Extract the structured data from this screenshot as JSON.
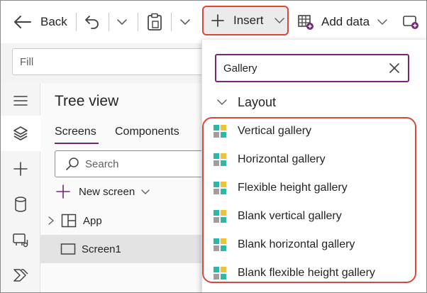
{
  "toolbar": {
    "back_label": "Back",
    "insert_label": "Insert",
    "add_data_label": "Add data"
  },
  "formula": {
    "property_value": "Fill"
  },
  "tree": {
    "title": "Tree view",
    "tabs": [
      {
        "label": "Screens",
        "active": true
      },
      {
        "label": "Components",
        "active": false
      }
    ],
    "search_placeholder": "Search",
    "new_screen_label": "New screen",
    "items": [
      {
        "label": "App",
        "icon": "app-icon"
      },
      {
        "label": "Screen1",
        "icon": "screen-icon",
        "selected": true
      }
    ]
  },
  "insert_menu": {
    "search_value": "Gallery",
    "section_label": "Layout",
    "items": [
      {
        "label": "Vertical gallery"
      },
      {
        "label": "Horizontal gallery"
      },
      {
        "label": "Flexible height gallery"
      },
      {
        "label": "Blank vertical gallery"
      },
      {
        "label": "Blank horizontal gallery"
      },
      {
        "label": "Blank flexible height gallery"
      }
    ]
  },
  "colors": {
    "accent_purple": "#742774",
    "highlight_red": "#d9473e",
    "gallery_icon_teal": "#2fb7a5",
    "gallery_icon_yellow": "#f0c23b",
    "gallery_icon_gray": "#9e9e9e"
  }
}
